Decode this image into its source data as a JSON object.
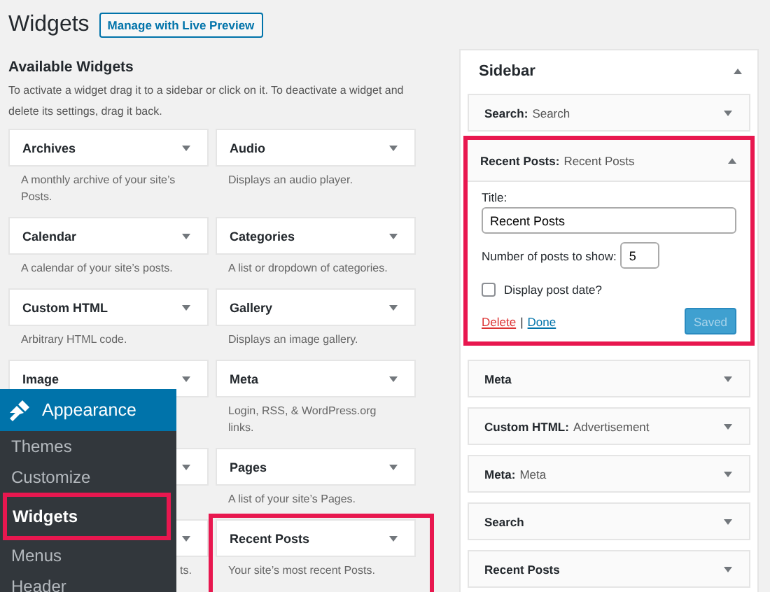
{
  "page": {
    "title": "Widgets",
    "preview_button": "Manage with Live Preview"
  },
  "available": {
    "heading": "Available Widgets",
    "description": "To activate a widget drag it to a sidebar or click on it. To deactivate a widget and delete its settings, drag it back.",
    "widgets": [
      {
        "kind": "widget",
        "title": "Archives",
        "description": "A monthly archive of your site’s Posts."
      },
      {
        "kind": "widget",
        "title": "Audio",
        "description": "Displays an audio player."
      },
      {
        "kind": "widget",
        "title": "Calendar",
        "description": "A calendar of your site’s posts."
      },
      {
        "kind": "widget",
        "title": "Categories",
        "description": "A list or dropdown of categories."
      },
      {
        "kind": "widget",
        "title": "Custom HTML",
        "description": "Arbitrary HTML code."
      },
      {
        "kind": "widget",
        "title": "Gallery",
        "description": "Displays an image gallery."
      },
      {
        "kind": "widget",
        "title": "Image"
      },
      {
        "kind": "widget",
        "title": "Meta",
        "description": "Login, RSS, & WordPress.org links."
      },
      {
        "kind": "covered"
      },
      {
        "kind": "widget",
        "title": "Pages",
        "description": "A list of your site’s Pages."
      },
      {
        "kind": "cut",
        "description": "ts."
      },
      {
        "kind": "widget",
        "title": "Recent Posts",
        "description": "Your site’s most recent Posts.",
        "highlighted": true
      }
    ]
  },
  "sidebar": {
    "title": "Sidebar",
    "expanded": true,
    "widgets": [
      {
        "name": "Search:",
        "title": "Search",
        "expanded": false
      },
      {
        "name": "Recent Posts:",
        "title": "Recent Posts",
        "expanded": true,
        "highlighted": true,
        "form": {
          "title_label": "Title:",
          "title_value": "Recent Posts",
          "number_label": "Number of posts to show:",
          "number_value": "5",
          "checkbox": {
            "label": "Display post date?",
            "checked": false
          },
          "delete": "Delete",
          "separator": "|",
          "done": "Done",
          "save_button": {
            "label": "Saved",
            "disabled": true
          }
        }
      },
      {
        "name": "Meta",
        "expanded": false
      },
      {
        "name": "Custom HTML:",
        "title": "Advertisement",
        "expanded": false
      },
      {
        "name": "Meta:",
        "title": "Meta",
        "expanded": false
      },
      {
        "name": "Search",
        "expanded": false
      },
      {
        "name": "Recent Posts",
        "expanded": false
      }
    ]
  },
  "admin_menu": {
    "title": "Appearance",
    "items": [
      {
        "label": "Themes",
        "selected": false
      },
      {
        "label": "Customize",
        "selected": false
      },
      {
        "label": "Widgets",
        "selected": true,
        "highlighted": true
      },
      {
        "label": "Menus",
        "selected": false
      },
      {
        "label": "Header",
        "selected": false
      }
    ]
  }
}
